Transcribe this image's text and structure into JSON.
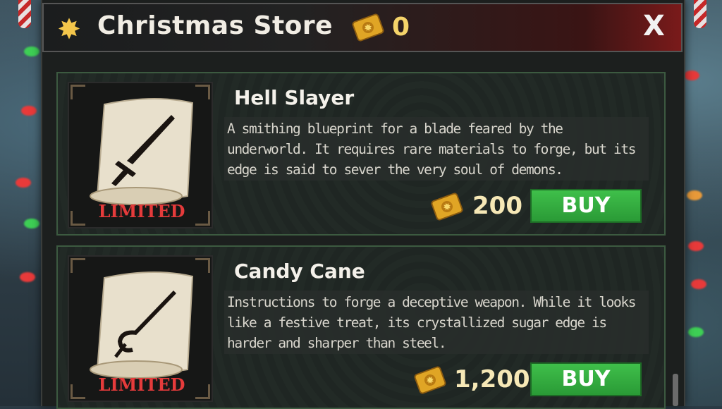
{
  "header": {
    "title": "Christmas Store",
    "star_icon": "sun-star-icon",
    "currency_icon": "golden-ticket-icon",
    "currency_amount": "0",
    "close_label": "X"
  },
  "items": [
    {
      "name": "Hell Slayer",
      "badge": "LIMITED",
      "description": "A smithing blueprint for a blade feared by the underworld. It requires rare materials to forge, but its edge is said to sever the very soul of demons.",
      "price": "200",
      "buy_label": "BUY",
      "icon": "sword-blueprint-scroll-icon"
    },
    {
      "name": "Candy Cane",
      "badge": "LIMITED",
      "description": "Instructions to forge a deceptive weapon. While it looks like a festive treat, its crystallized sugar edge is harder and sharper than steel.",
      "price": "1,200",
      "buy_label": "BUY",
      "icon": "cane-blueprint-scroll-icon"
    }
  ],
  "colors": {
    "accent_gold": "#f3c64b",
    "limited_red": "#e53b3b",
    "buy_green": "#3fbf4a",
    "header_red": "#7a1a1a"
  }
}
